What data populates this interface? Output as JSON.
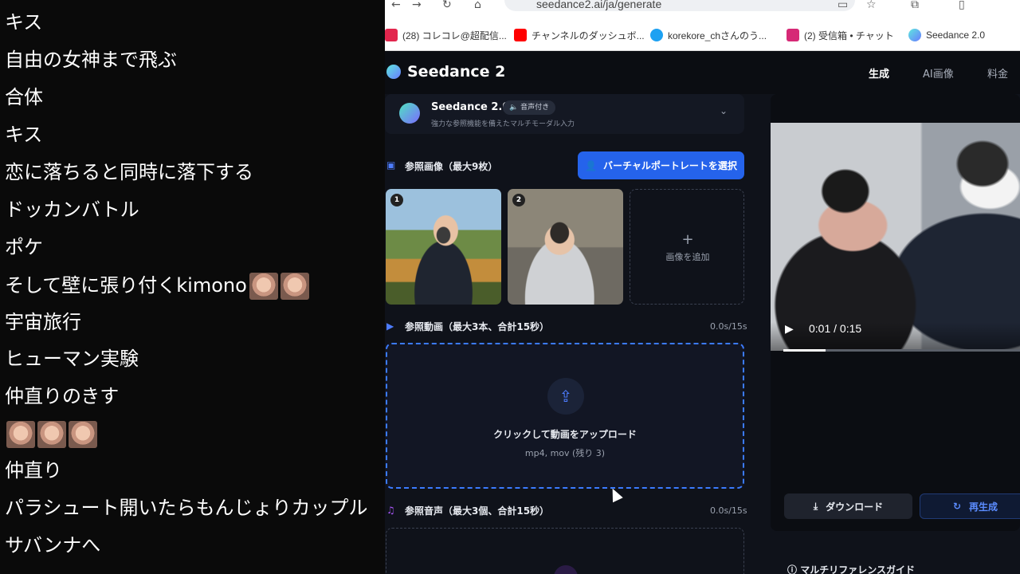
{
  "comments": {
    "lines": [
      "キス",
      "自由の女神まで飛ぶ",
      "合体",
      "キス",
      "恋に落ちると同時に落下する",
      "ドッカンバトル",
      "ポケ",
      "そして壁に張り付くkimono",
      "宇宙旅行",
      "ヒューマン実験",
      "仲直りのきす",
      "仲直り",
      "パラシュート開いたらもんじょりカップル",
      "サバンナへ"
    ]
  },
  "browser": {
    "url": "seedance2.ai/ja/generate",
    "bookmarks": [
      {
        "label": "(28) コレコレ@超配信...",
        "icon": "tiktok-icon",
        "color": "#e2264d"
      },
      {
        "label": "チャンネルのダッシュボ...",
        "icon": "youtube-icon",
        "color": "#ff0000"
      },
      {
        "label": "korekore_chさんのう...",
        "icon": "cloud-icon",
        "color": "#1da1f2"
      },
      {
        "label": "(2) 受信箱 • チャット",
        "icon": "instagram-icon",
        "color": "#d62976"
      },
      {
        "label": "Seedance 2.0",
        "icon": "seedance-icon",
        "color": "#6a7bff"
      }
    ]
  },
  "app": {
    "brand": "Seedance 2",
    "nav": [
      "生成",
      "AI画像",
      "料金"
    ],
    "model": {
      "name": "Seedance 2.0",
      "badge": "音声付き",
      "description": "強力な参照機能を備えたマルチモーダル入力"
    },
    "ref_images": {
      "title": "参照画像（最大9枚）",
      "button": "バーチャルポートレートを選択",
      "thumbs": [
        "1",
        "2"
      ],
      "add_label": "画像を追加"
    },
    "ref_video": {
      "title": "参照動画（最大3本、合計15秒）",
      "duration": "0.0s/15s",
      "upload_label": "クリックして動画をアップロード",
      "upload_sub": "mp4, mov (残り 3)"
    },
    "ref_audio": {
      "title": "参照音声（最大3個、合計15秒）",
      "duration": "0.0s/15s"
    },
    "preview": {
      "timecode": "0:01 / 0:15",
      "progress": 0.18
    },
    "actions": {
      "download": "ダウンロード",
      "regenerate": "再生成"
    },
    "guide": "マルチリファレンスガイド"
  },
  "colors": {
    "accent": "#2563eb",
    "upload_border": "#3b7bff"
  }
}
